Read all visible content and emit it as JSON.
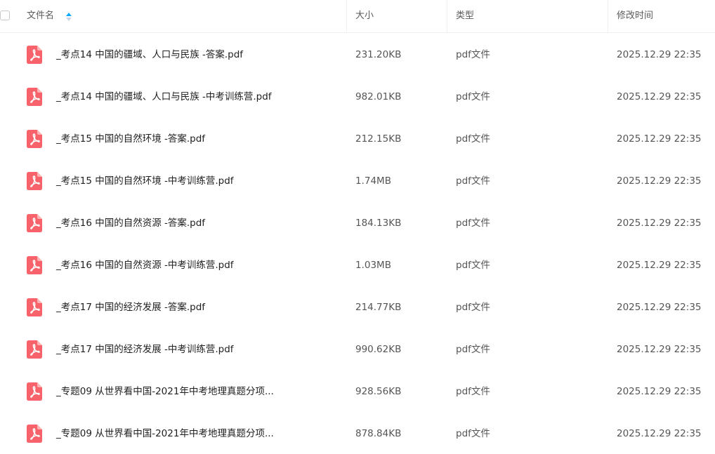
{
  "header": {
    "name": "文件名",
    "size": "大小",
    "type": "类型",
    "modified": "修改时间"
  },
  "files": [
    {
      "name": "_考点14 中国的疆域、人口与民族 -答案.pdf",
      "size": "231.20KB",
      "type": "pdf文件",
      "modified": "2025.12.29 22:35"
    },
    {
      "name": "_考点14 中国的疆域、人口与民族 -中考训练营.pdf",
      "size": "982.01KB",
      "type": "pdf文件",
      "modified": "2025.12.29 22:35"
    },
    {
      "name": "_考点15 中国的自然环境 -答案.pdf",
      "size": "212.15KB",
      "type": "pdf文件",
      "modified": "2025.12.29 22:35"
    },
    {
      "name": "_考点15 中国的自然环境 -中考训练营.pdf",
      "size": "1.74MB",
      "type": "pdf文件",
      "modified": "2025.12.29 22:35"
    },
    {
      "name": "_考点16 中国的自然资源 -答案.pdf",
      "size": "184.13KB",
      "type": "pdf文件",
      "modified": "2025.12.29 22:35"
    },
    {
      "name": "_考点16 中国的自然资源 -中考训练营.pdf",
      "size": "1.03MB",
      "type": "pdf文件",
      "modified": "2025.12.29 22:35"
    },
    {
      "name": "_考点17 中国的经济发展 -答案.pdf",
      "size": "214.77KB",
      "type": "pdf文件",
      "modified": "2025.12.29 22:35"
    },
    {
      "name": "_考点17 中国的经济发展 -中考训练营.pdf",
      "size": "990.62KB",
      "type": "pdf文件",
      "modified": "2025.12.29 22:35"
    },
    {
      "name": "_专题09 从世界看中国-2021年中考地理真题分项...",
      "size": "928.56KB",
      "type": "pdf文件",
      "modified": "2025.12.29 22:35"
    },
    {
      "name": "_专题09 从世界看中国-2021年中考地理真题分项...",
      "size": "878.84KB",
      "type": "pdf文件",
      "modified": "2025.12.29 22:35"
    }
  ],
  "icons": {
    "file": "pdf-icon",
    "sort": "sort-ascending-icon",
    "select": "checkbox-icon"
  },
  "colors": {
    "pdf_icon": "#f8626a",
    "sort_active": "#06a7ff",
    "sort_inactive": "#c5d4e6"
  }
}
